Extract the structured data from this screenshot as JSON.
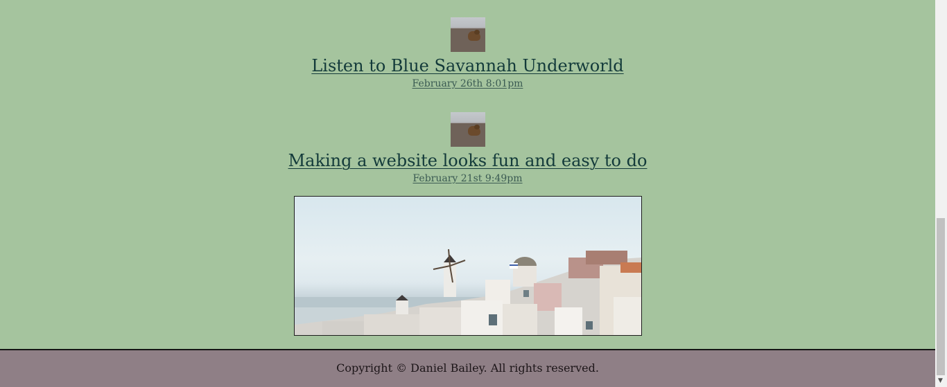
{
  "posts": [
    {
      "title": "Listen to Blue Savannah Underworld",
      "date": "February 26th 8:01pm",
      "thumbnail_icon": "marmot-photo"
    },
    {
      "title": "Making a website looks fun and easy to do",
      "date": "February 21st 9:49pm",
      "thumbnail_icon": "marmot-photo"
    }
  ],
  "hero_image": {
    "icon": "santorini-village-photo"
  },
  "footer": {
    "copyright": "Copyright © Daniel Bailey. All rights reserved."
  },
  "colors": {
    "page_background": "#a5c49e",
    "footer_background": "#8f7f86",
    "link_color": "#133a3a"
  }
}
